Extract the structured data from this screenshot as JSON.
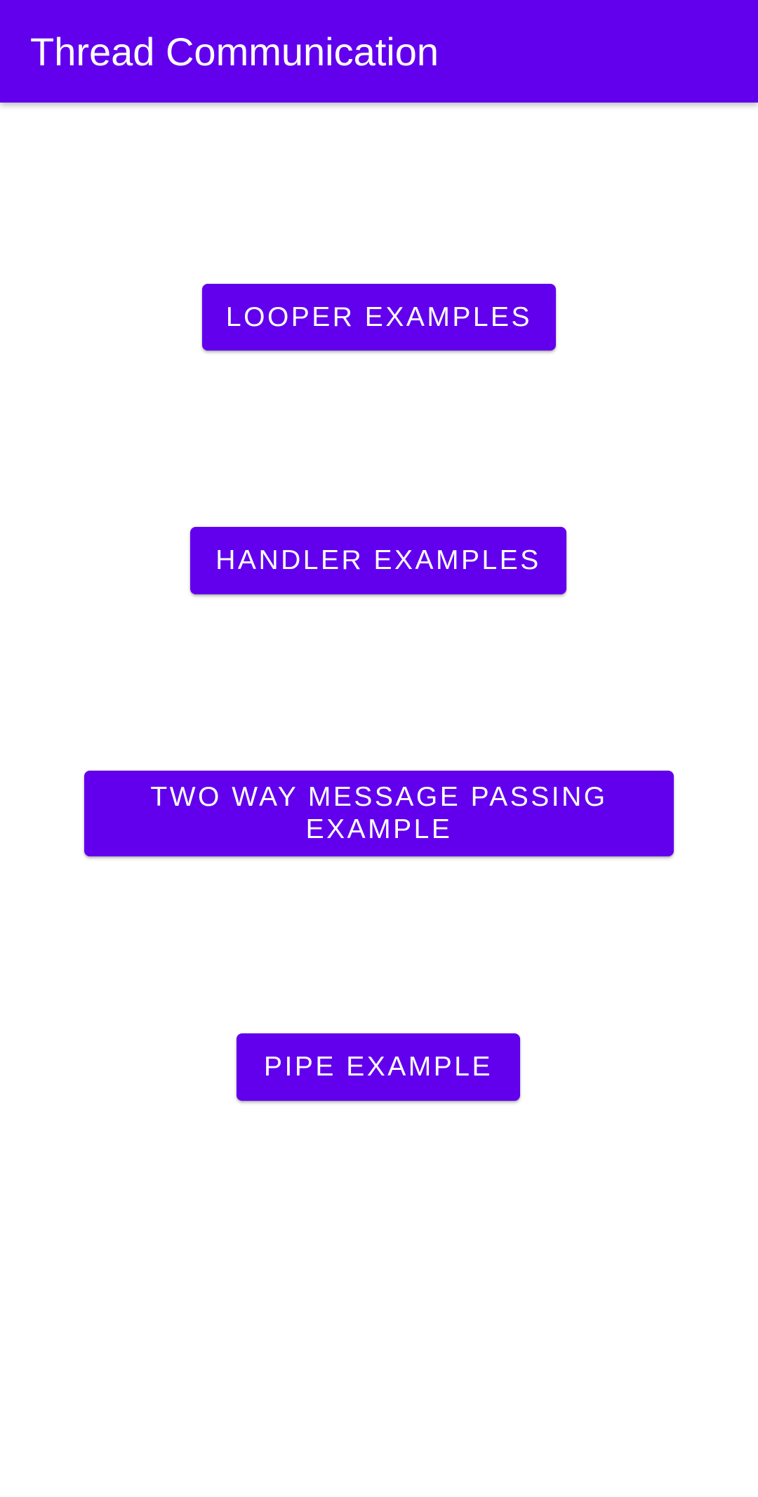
{
  "app_bar": {
    "title": "Thread Communication",
    "color": "#6200EE"
  },
  "buttons": {
    "looper": "LOOPER EXAMPLES",
    "handler": "HANDLER EXAMPLES",
    "two_way": "TWO WAY MESSAGE PASSING EXAMPLE",
    "pipe": "PIPE EXAMPLE"
  },
  "colors": {
    "primary": "#6200EE",
    "on_primary": "#FFFFFF",
    "background": "#FFFFFF"
  }
}
